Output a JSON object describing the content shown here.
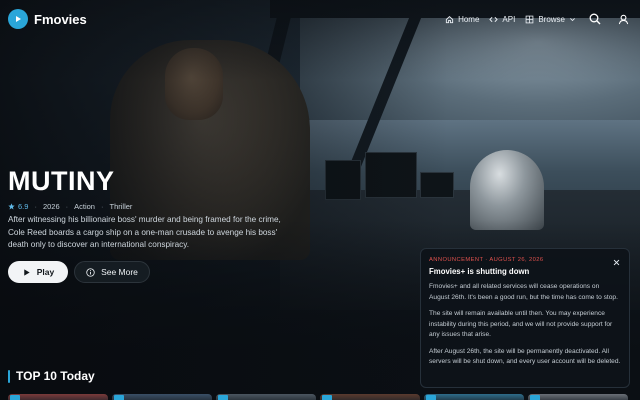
{
  "brand": {
    "name": "Fmovies",
    "accent": "#2aa6d9"
  },
  "nav": {
    "home": "Home",
    "api": "API",
    "browse": "Browse",
    "icons": [
      "home-icon",
      "code-icon",
      "grid-icon",
      "chevron-down-icon",
      "search-icon",
      "user-icon"
    ]
  },
  "hero": {
    "title": "MUTINY",
    "rating": "6.9",
    "year": "2026",
    "genres": [
      "Action",
      "Thriller"
    ],
    "description": "After witnessing his billionaire boss' murder and being framed for the crime, Cole Reed boards a cargo ship on a one-man crusade to avenge his boss' death only to discover an international conspiracy.",
    "play_label": "Play",
    "more_label": "See More"
  },
  "section": {
    "title": "TOP 10 Today"
  },
  "thumbnails": [
    {
      "color": "#7a3a3a"
    },
    {
      "color": "#3a4f66"
    },
    {
      "color": "#4c5660"
    },
    {
      "color": "#5a3a2e"
    },
    {
      "color": "#2e6c8a"
    },
    {
      "color": "#6a6f77"
    }
  ],
  "announcement": {
    "label": "ANNOUNCEMENT · AUGUST 26, 2026",
    "title": "Fmovies+ is shutting down",
    "paragraphs": [
      "Fmovies+ and all related services will cease operations on August 26th. It's been a good run, but the time has come to stop.",
      "The site will remain available until then. You may experience instability during this period, and we will not provide support for any issues that arise.",
      "After August 26th, the site will be permanently deactivated. All servers will be shut down, and every user account will be deleted."
    ]
  }
}
